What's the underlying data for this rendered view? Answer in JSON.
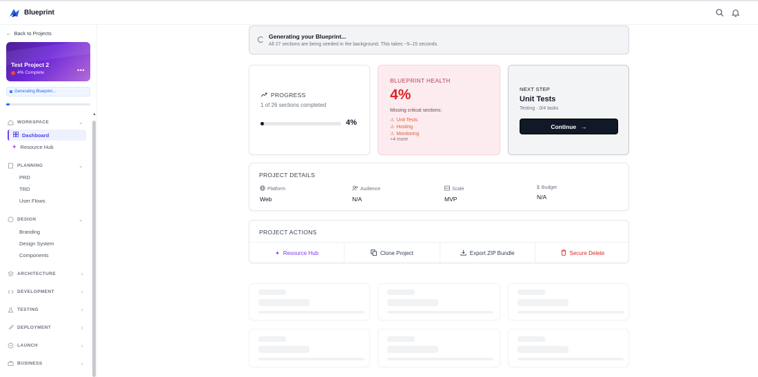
{
  "app": {
    "title": "Blueprint"
  },
  "sidebar": {
    "back_label": "Back to Projects",
    "project": {
      "name": "Test Project 2",
      "status": "4% Complete",
      "progress": 0.04
    },
    "generating_label": "Generating Blueprint...",
    "sections": {
      "workspace": {
        "label": "WORKSPACE",
        "items": [
          "Dashboard",
          "Resource Hub"
        ]
      },
      "planning": {
        "label": "PLANNING",
        "items": [
          "PRD",
          "TRD",
          "User Flows"
        ]
      },
      "design": {
        "label": "DESIGN",
        "items": [
          "Branding",
          "Design System",
          "Components"
        ]
      },
      "architecture": {
        "label": "ARCHITECTURE"
      },
      "development": {
        "label": "DEVELOPMENT"
      },
      "testing": {
        "label": "TESTING"
      },
      "deployment": {
        "label": "DEPLOYMENT"
      },
      "launch": {
        "label": "LAUNCH"
      },
      "business": {
        "label": "BUSINESS"
      }
    }
  },
  "banner": {
    "title": "Generating your Blueprint...",
    "subtitle": "All 27 sections are being seeded in the background. This takes ~5–15 seconds."
  },
  "progress_card": {
    "label": "PROGRESS",
    "subtitle": "1 of 26 sections completed",
    "percent_label": "4%",
    "value": 0.04
  },
  "health_card": {
    "label": "BLUEPRINT HEALTH",
    "value": "4%",
    "missing_label": "Missing critical sections:",
    "missing": [
      "Unit Tests",
      "Hosting",
      "Monitoring"
    ],
    "more": "+4 more"
  },
  "next_step": {
    "label": "NEXT STEP",
    "title": "Unit Tests",
    "subtitle": "Testing · 0/4 tasks",
    "button": "Continue"
  },
  "project_details": {
    "label": "PROJECT DETAILS",
    "fields": [
      {
        "key": "Platform",
        "value": "Web"
      },
      {
        "key": "Audience",
        "value": "N/A"
      },
      {
        "key": "Scale",
        "value": "MVP"
      },
      {
        "key": "Budget",
        "value": "N/A"
      }
    ]
  },
  "project_actions": {
    "label": "PROJECT ACTIONS",
    "actions": [
      "Resource Hub",
      "Clone Project",
      "Export ZIP Bundle",
      "Secure Delete"
    ]
  },
  "colors": {
    "accent": "#7c3aed",
    "danger": "#dc2626",
    "health_bg": "#fdecef",
    "primary_button": "#111827",
    "active_nav": "#4f46e5"
  }
}
